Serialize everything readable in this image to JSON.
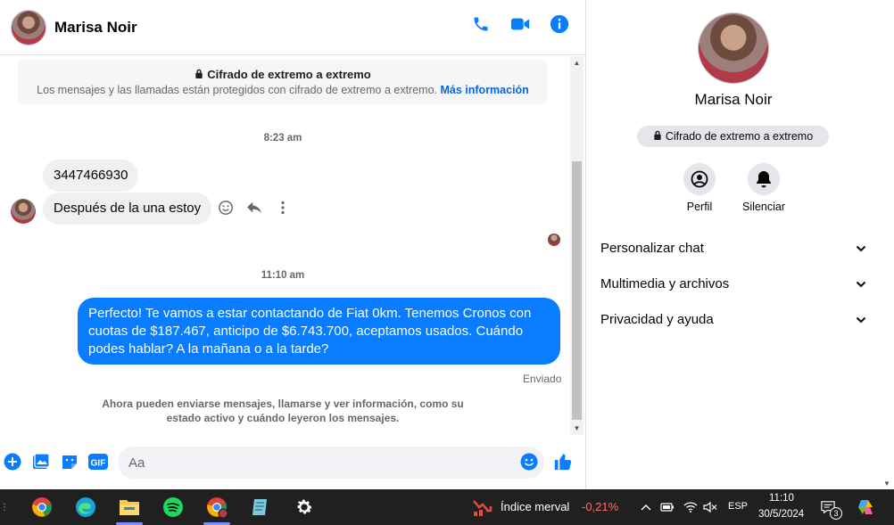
{
  "contact": {
    "name": "Marisa Noir"
  },
  "colors": {
    "accent": "#0a7cff",
    "incoming_bubble": "#f0f0f0",
    "negative": "#ff6b6b"
  },
  "header": {
    "icons": [
      "phone-icon",
      "video-call-icon",
      "info-icon"
    ]
  },
  "e2e": {
    "title": "Cifrado de extremo a extremo",
    "description": "Los mensajes y las llamadas están protegidos con cifrado de extremo a extremo.",
    "link": "Más información"
  },
  "messages": {
    "time1": "8:23 am",
    "incoming1": "3447466930",
    "incoming2": "Después de la una estoy",
    "time2": "11:10 am",
    "outgoing": "Perfecto! Te vamos a estar contactando de Fiat 0km. Tenemos Cronos con cuotas de $187.467, anticipo de $6.743.700, aceptamos usados. Cuándo podes hablar? A la mañana o a la tarde?",
    "status": "Enviado",
    "info": "Ahora pueden enviarse mensajes, llamarse y ver información, como su estado activo y cuándo leyeron los mensajes."
  },
  "composer": {
    "placeholder": "Aa"
  },
  "panel": {
    "name": "Marisa Noir",
    "badge": "Cifrado de extremo a extremo",
    "actions": [
      {
        "label": "Perfil"
      },
      {
        "label": "Silenciar"
      }
    ],
    "sections": [
      {
        "label": "Personalizar chat"
      },
      {
        "label": "Multimedia y archivos"
      },
      {
        "label": "Privacidad y ayuda"
      }
    ]
  },
  "taskbar": {
    "weather_label": "Índice merval",
    "weather_value": "-0,21%",
    "lang": "ESP",
    "time": "11:10",
    "date": "30/5/2024",
    "notifications": "3"
  }
}
